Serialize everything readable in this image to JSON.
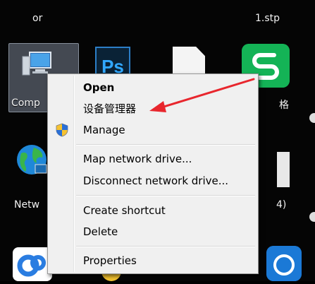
{
  "desktop": {
    "top_left_label": "or",
    "top_right_label": "1.stp",
    "computer_label": "Comp",
    "right_icon_label": "格",
    "network_label": "Netw",
    "right_icon_label_2": "4)"
  },
  "context_menu": {
    "items": [
      {
        "label": "Open",
        "bold": true
      },
      {
        "label": "设备管理器"
      },
      {
        "label": "Manage",
        "icon": "uac-shield-icon"
      },
      {
        "label": "Map network drive..."
      },
      {
        "label": "Disconnect network drive..."
      },
      {
        "label": "Create shortcut"
      },
      {
        "label": "Delete"
      },
      {
        "label": "Properties"
      }
    ]
  },
  "annotation": {
    "arrow_color": "#e8262d"
  },
  "colors": {
    "menu_bg": "#f0f0f0",
    "selection": "#7f8896",
    "ps_blue": "#31a8ff",
    "green_app": "#14b356"
  }
}
